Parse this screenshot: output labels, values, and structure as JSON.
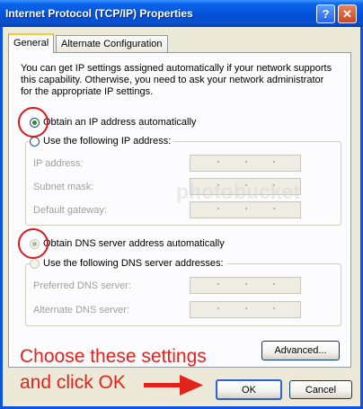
{
  "window": {
    "title": "Internet Protocol (TCP/IP) Properties",
    "help_glyph": "?",
    "close_glyph": "✕"
  },
  "tabs": [
    {
      "label": "General",
      "active": true
    },
    {
      "label": "Alternate Configuration",
      "active": false
    }
  ],
  "intro_text": "You can get IP settings assigned automatically if your network supports this capability. Otherwise, you need to ask your network administrator for the appropriate IP settings.",
  "ip": {
    "auto_label": "Obtain an IP address automatically",
    "manual_label": "Use the following IP address:",
    "fields": [
      {
        "label": "IP address:"
      },
      {
        "label": "Subnet mask:"
      },
      {
        "label": "Default gateway:"
      }
    ]
  },
  "dns": {
    "auto_label": "Obtain DNS server address automatically",
    "manual_label": "Use the following DNS server addresses:",
    "fields": [
      {
        "label": "Preferred DNS server:"
      },
      {
        "label": "Alternate DNS server:"
      }
    ]
  },
  "buttons": {
    "advanced": "Advanced...",
    "ok": "OK",
    "cancel": "Cancel"
  },
  "annotation": {
    "line1": "Choose these settings",
    "line2": "and click OK"
  },
  "watermark": "photobucket",
  "colors": {
    "annotation": "#e3221b",
    "titlebar": "#0a54e0",
    "accent_tab": "#ffc83c"
  }
}
